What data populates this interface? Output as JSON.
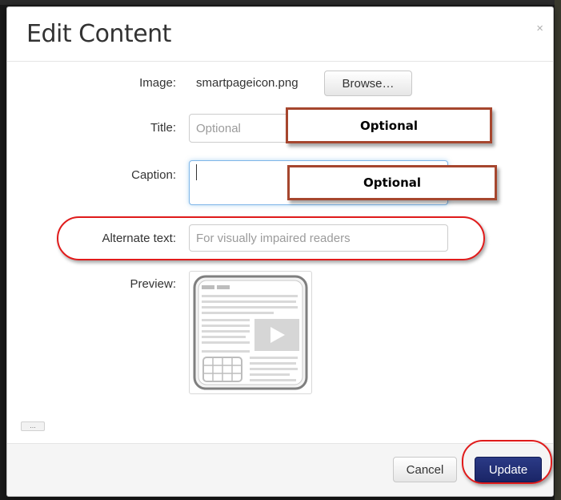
{
  "dialog": {
    "title": "Edit Content",
    "close_glyph": "×"
  },
  "fields": {
    "image": {
      "label": "Image:",
      "filename": "smartpageicon.png",
      "browse_label": "Browse…"
    },
    "title": {
      "label": "Title:",
      "placeholder": "Optional",
      "value": ""
    },
    "caption": {
      "label": "Caption:",
      "value": ""
    },
    "alternate_text": {
      "label": "Alternate text:",
      "placeholder": "For visually impaired readers",
      "value": ""
    },
    "preview": {
      "label": "Preview:"
    }
  },
  "annotations": {
    "title_callout": "Optional",
    "caption_callout": "Optional"
  },
  "more_button": "...",
  "footer": {
    "cancel_label": "Cancel",
    "update_label": "Update"
  },
  "colors": {
    "primary_button": "#1a2566",
    "callout_border": "#a6462e",
    "highlight_ring": "#e01b1b"
  },
  "icons": {
    "preview_thumbnail": "smartpage-document-icon",
    "close": "close-icon"
  }
}
